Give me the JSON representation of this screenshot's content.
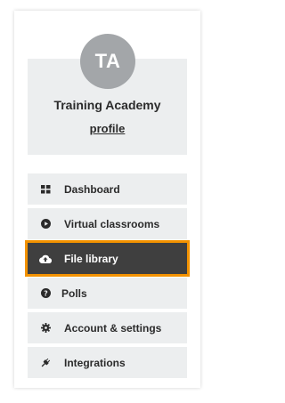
{
  "profile": {
    "initials": "TA",
    "name": "Training Academy",
    "link_label": "profile"
  },
  "nav": {
    "items": [
      {
        "label": "Dashboard",
        "icon": "grid-icon",
        "active": false
      },
      {
        "label": "Virtual classrooms",
        "icon": "play-circle-icon",
        "active": false
      },
      {
        "label": "File library",
        "icon": "cloud-upload-icon",
        "active": true
      },
      {
        "label": "Polls",
        "icon": "question-circle-icon",
        "active": false
      },
      {
        "label": "Account & settings",
        "icon": "gear-icon",
        "active": false
      },
      {
        "label": "Integrations",
        "icon": "plug-icon",
        "active": false
      }
    ]
  },
  "colors": {
    "accent": "#f39200",
    "active_bg": "#3f3f3f",
    "item_bg": "#eceeef",
    "avatar_bg": "#a3a6a9"
  }
}
